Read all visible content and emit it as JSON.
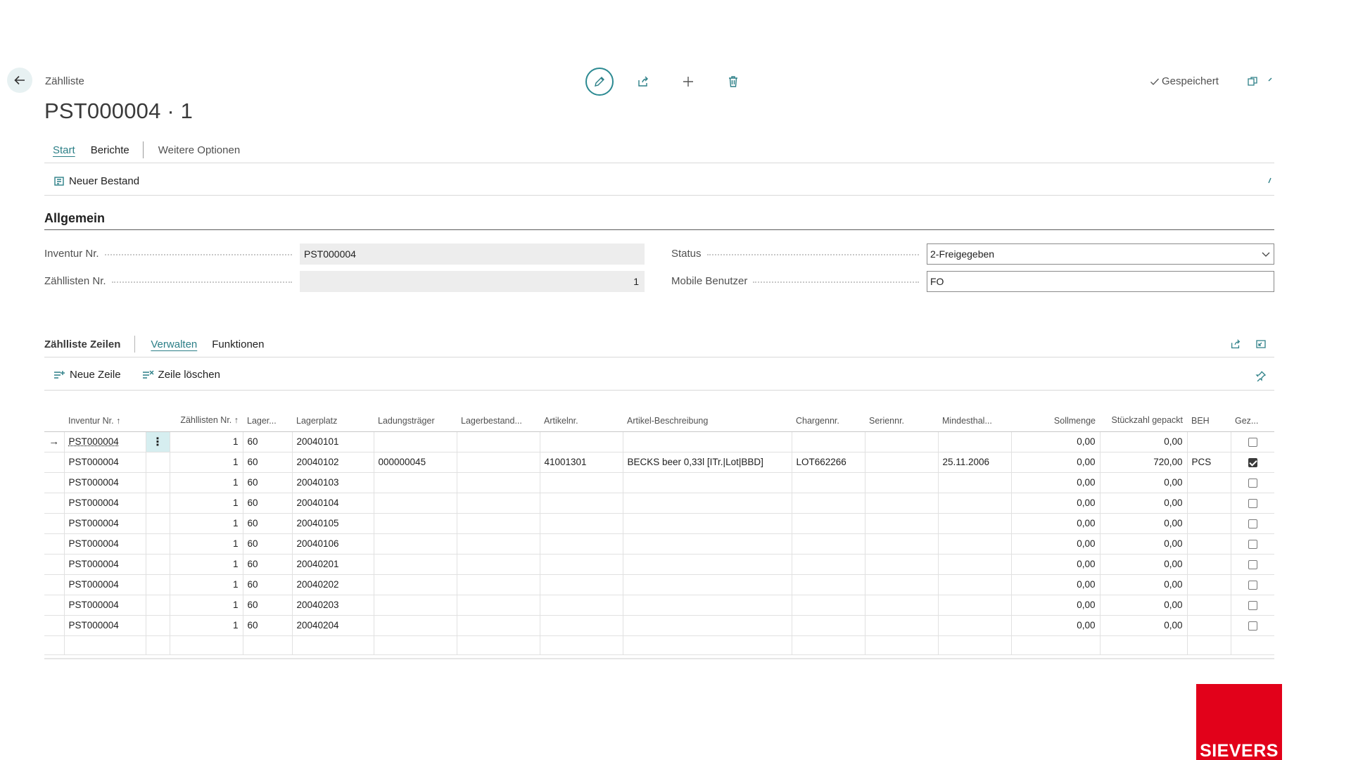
{
  "header": {
    "caption": "Zählliste",
    "title": "PST000004 · 1",
    "saved_label": "Gespeichert"
  },
  "action_bar": {
    "tabs": [
      "Start",
      "Berichte"
    ],
    "more_options": "Weitere Optionen",
    "actions": [
      {
        "label": "Neuer Bestand",
        "icon": "new-stock-icon"
      }
    ]
  },
  "general": {
    "title": "Allgemein",
    "fields": {
      "inventur_nr": {
        "label": "Inventur Nr.",
        "value": "PST000004"
      },
      "zaehllisten_nr": {
        "label": "Zähllisten Nr.",
        "value": "1"
      },
      "status": {
        "label": "Status",
        "value": "2-Freigegeben"
      },
      "mobile_benutzer": {
        "label": "Mobile Benutzer",
        "value": "FO"
      }
    }
  },
  "lines": {
    "title": "Zählliste Zeilen",
    "tabs": [
      "Verwalten",
      "Funktionen"
    ],
    "actions": [
      {
        "label": "Neue Zeile",
        "icon": "new-line-icon"
      },
      {
        "label": "Zeile löschen",
        "icon": "delete-line-icon"
      }
    ],
    "columns": [
      "Inventur Nr. ↑",
      "Zähllisten Nr. ↑",
      "Lager...",
      "Lagerplatz",
      "Ladungsträger",
      "Lagerbestand...",
      "Artikelnr.",
      "Artikel-Beschreibung",
      "Chargennr.",
      "Seriennr.",
      "Mindesthal...",
      "Sollmenge",
      "Stückzahl gepackt",
      "BEH",
      "Gez..."
    ],
    "rows": [
      [
        "PST000004",
        "1",
        "60",
        "20040101",
        "",
        "",
        "",
        "",
        "",
        "",
        "",
        "0,00",
        "0,00",
        "",
        false
      ],
      [
        "PST000004",
        "1",
        "60",
        "20040102",
        "000000045",
        "",
        "41001301",
        "BECKS beer 0,33l [ITr.|Lot|BBD]",
        "LOT662266",
        "",
        "25.11.2006",
        "0,00",
        "720,00",
        "PCS",
        true
      ],
      [
        "PST000004",
        "1",
        "60",
        "20040103",
        "",
        "",
        "",
        "",
        "",
        "",
        "",
        "0,00",
        "0,00",
        "",
        false
      ],
      [
        "PST000004",
        "1",
        "60",
        "20040104",
        "",
        "",
        "",
        "",
        "",
        "",
        "",
        "0,00",
        "0,00",
        "",
        false
      ],
      [
        "PST000004",
        "1",
        "60",
        "20040105",
        "",
        "",
        "",
        "",
        "",
        "",
        "",
        "0,00",
        "0,00",
        "",
        false
      ],
      [
        "PST000004",
        "1",
        "60",
        "20040106",
        "",
        "",
        "",
        "",
        "",
        "",
        "",
        "0,00",
        "0,00",
        "",
        false
      ],
      [
        "PST000004",
        "1",
        "60",
        "20040201",
        "",
        "",
        "",
        "",
        "",
        "",
        "",
        "0,00",
        "0,00",
        "",
        false
      ],
      [
        "PST000004",
        "1",
        "60",
        "20040202",
        "",
        "",
        "",
        "",
        "",
        "",
        "",
        "0,00",
        "0,00",
        "",
        false
      ],
      [
        "PST000004",
        "1",
        "60",
        "20040203",
        "",
        "",
        "",
        "",
        "",
        "",
        "",
        "0,00",
        "0,00",
        "",
        false
      ],
      [
        "PST000004",
        "1",
        "60",
        "20040204",
        "",
        "",
        "",
        "",
        "",
        "",
        "",
        "0,00",
        "0,00",
        "",
        false
      ]
    ]
  },
  "brand": {
    "logo_text": "SIEVERS",
    "color": "#e2011a"
  },
  "colors": {
    "accent": "#2c7f87"
  }
}
